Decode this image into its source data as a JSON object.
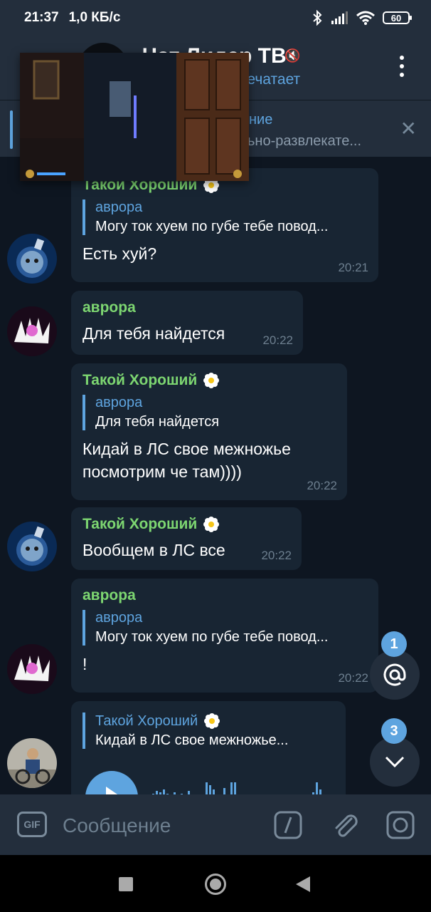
{
  "status_bar": {
    "time": "21:37",
    "speed": "1,0 КБ/с",
    "battery": "60"
  },
  "header": {
    "title": "Чат Лидер ТВ",
    "subtitle": "печатает"
  },
  "pinned": {
    "title": "ние",
    "text": "ьно-развлекате..."
  },
  "messages": [
    {
      "name": "Такой Хороший",
      "reply_name": "аврора",
      "reply_text": "Могу ток хуем по губе тебе повод...",
      "text": "Есть хуй?",
      "time": "20:21"
    },
    {
      "name": "аврора",
      "text": "Для тебя найдется",
      "time": "20:22"
    },
    {
      "name": "Такой Хороший",
      "reply_name": "аврора",
      "reply_text": "Для тебя найдется",
      "text": "Кидай в ЛС свое межножье посмотрим че там))))",
      "time": "20:22"
    },
    {
      "name": "Такой Хороший",
      "text": "Вообщем в ЛС все",
      "time": "20:22"
    },
    {
      "name": "аврора",
      "reply_name": "аврора",
      "reply_text": "Могу ток хуем по губе тебе повод...",
      "text": "!",
      "time": "20:22"
    },
    {
      "reply_name": "Такой Хороший",
      "reply_text": "Кидай в ЛС свое межножье..."
    }
  ],
  "fabs": {
    "mentions_count": "1",
    "unread_count": "3"
  },
  "input": {
    "placeholder": "Сообщение",
    "gif_label": "GIF"
  },
  "colors": {
    "accent": "#5ea4df",
    "name_green": "#7dd671",
    "bubble": "#182533",
    "background": "#0e1621"
  }
}
